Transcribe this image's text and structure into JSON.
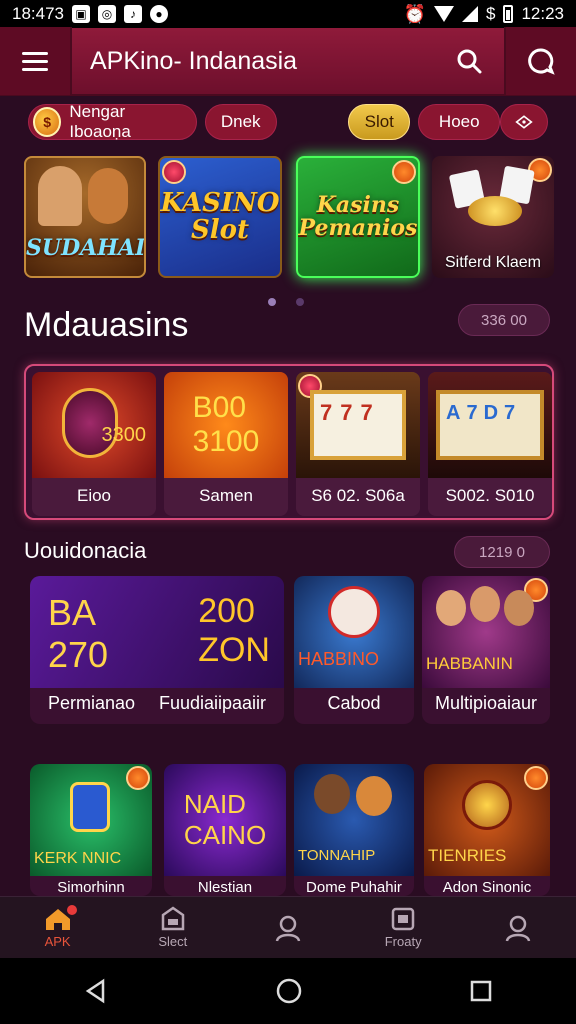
{
  "status_bar": {
    "time_left": "18:473",
    "time_right": "12:23",
    "icons_left": [
      "photo-icon",
      "music-icon",
      "tiktok-icon",
      "instagram-icon"
    ],
    "icons_right": [
      "alarm-icon",
      "wifi-icon",
      "signal-icon",
      "dollar-icon",
      "battery-icon"
    ],
    "dollar": "$"
  },
  "header": {
    "title": "APKino- Indanasia"
  },
  "chips": {
    "user_label": "Nengar Iboaoṇa",
    "user_avatar": "$",
    "chip_2": "Dnek",
    "chip_3": "Slot",
    "chip_4": "Hoeo",
    "chip_5_icon": "chip-icon"
  },
  "top_games": [
    {
      "art_text": "SUDAHAI",
      "caption": ""
    },
    {
      "art_text": "KASINO\nSlot",
      "caption": ""
    },
    {
      "art_text": "Kasins\nPemanios",
      "caption": ""
    },
    {
      "art_text": "",
      "caption": "Sitferd Klaem"
    }
  ],
  "section1": {
    "title": "Mdauasins",
    "meta": "336 00"
  },
  "row1": [
    {
      "art_text": "3300",
      "caption": "Eioo"
    },
    {
      "art_text": "B00\n3100",
      "caption": "Samen"
    },
    {
      "art_text": "",
      "caption": "S6 02. S06a"
    },
    {
      "art_text": "",
      "caption": "S002. S010"
    }
  ],
  "section2": {
    "title": "Uouidonacia",
    "meta": "1219 0"
  },
  "row2": [
    {
      "art_text": "BA\n270",
      "caption": "Permianao"
    },
    {
      "art_text": "200\nZON",
      "caption": "Fuudiaiipaaiir"
    },
    {
      "art_text": "HABBINO",
      "caption": "Cabod"
    },
    {
      "art_text": "HABBANIN",
      "caption": "Multipioaiaur"
    }
  ],
  "row3": [
    {
      "art_text": "KERK NNIC",
      "caption": "Simorhinn"
    },
    {
      "art_text": "NAID\nCAINO",
      "caption": "Nlestian"
    },
    {
      "art_text": "TONNAHIP",
      "caption": "Dome Puhahir"
    },
    {
      "art_text": "TIENRIES",
      "caption": "Adon Sinonic"
    }
  ],
  "bottom_nav": [
    {
      "label": "APK",
      "icon": "home-icon"
    },
    {
      "label": "Slect",
      "icon": "slot-icon"
    },
    {
      "label": "",
      "icon": "user-icon"
    },
    {
      "label": "Froaty",
      "icon": "wallet-icon"
    },
    {
      "label": "",
      "icon": "profile-icon"
    }
  ],
  "colors": {
    "header": "#8f1a3a",
    "background": "#2a0c22",
    "accent_gold": "#f2c94c",
    "active_nav": "#e8543a"
  }
}
